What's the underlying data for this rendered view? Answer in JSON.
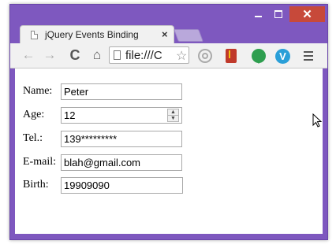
{
  "window": {
    "minimize_glyph": "",
    "close_glyph": "✕"
  },
  "tab": {
    "title": "jQuery Events Binding",
    "close_glyph": "×"
  },
  "toolbar": {
    "back_glyph": "←",
    "forward_glyph": "→",
    "reload_glyph": "C",
    "home_glyph": "⌂",
    "address_value": "file:///C",
    "star_glyph": "☆",
    "extension_v_glyph": "V"
  },
  "form": {
    "name_label": "Name:",
    "name_value": "Peter",
    "age_label": "Age:",
    "age_value": "12",
    "tel_label": "Tel.:",
    "tel_value": "139*********",
    "email_label": "E-mail:",
    "email_value": "blah@gmail.com",
    "birth_label": "Birth:",
    "birth_value": "19909090",
    "spin_up": "▲",
    "spin_down": "▼"
  },
  "colors": {
    "window_frame": "#7e58bf",
    "close_button": "#c7493a"
  }
}
